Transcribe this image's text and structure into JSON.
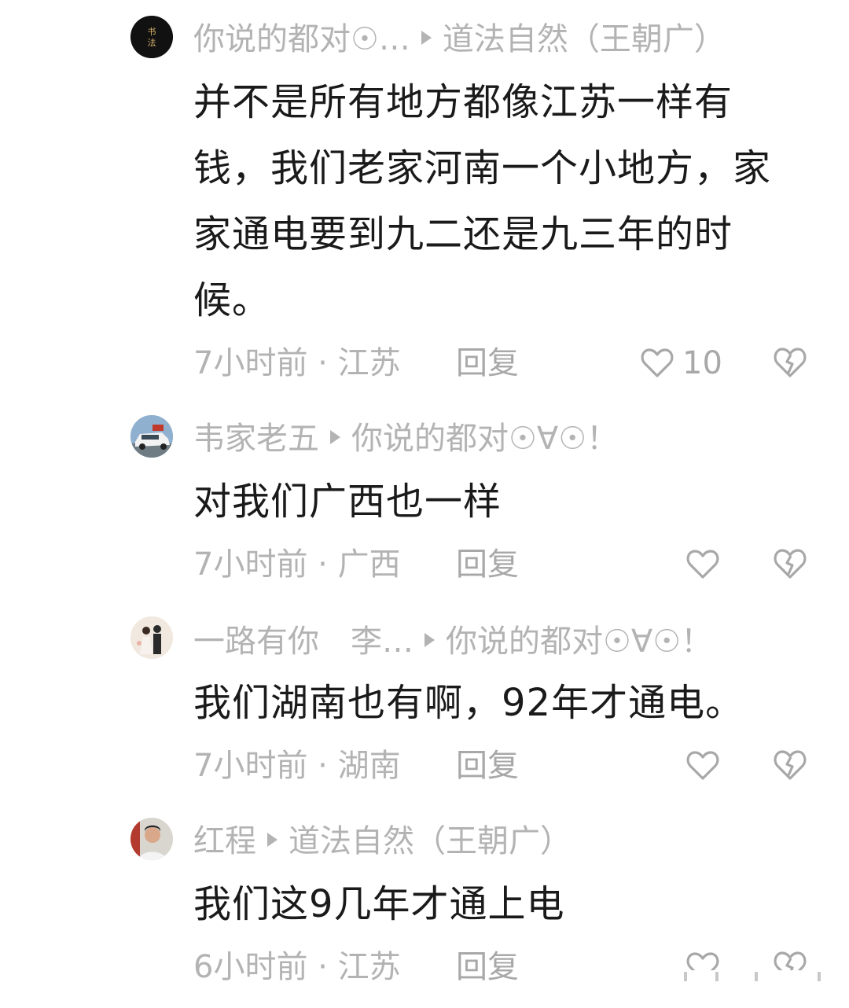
{
  "comments": [
    {
      "author": "你说的都对☉…",
      "reply_to": "道法自然（王朝广）",
      "text": "并不是所有地方都像江苏一样有钱，我们老家河南一个小地方，家家通电要到九二还是九三年的时候。",
      "time_location": "7小时前 · 江苏",
      "reply_label": "回复",
      "likes": "10",
      "avatar_icon": "calligraphy-avatar-icon"
    },
    {
      "author": "韦家老五",
      "reply_to": "你说的都对☉∀☉！",
      "text": "对我们广西也一样",
      "time_location": "7小时前 · 广西",
      "reply_label": "回复",
      "likes": "",
      "avatar_icon": "car-avatar-icon"
    },
    {
      "author": "一路有你　李…",
      "reply_to": "你说的都对☉∀☉！",
      "text": "我们湖南也有啊，92年才通电。",
      "time_location": "7小时前 · 湖南",
      "reply_label": "回复",
      "likes": "",
      "avatar_icon": "couple-photo-avatar-icon"
    },
    {
      "author": "红程",
      "reply_to": "道法自然（王朝广）",
      "text": "我们这9几年才通上电",
      "time_location": "6小时前 · 江苏",
      "reply_label": "回复",
      "likes": "",
      "avatar_icon": "man-photo-avatar-icon"
    }
  ],
  "colors": {
    "text": "#1a1a1a",
    "muted": "#b3b3b3",
    "icon": "#a8a8a8"
  }
}
